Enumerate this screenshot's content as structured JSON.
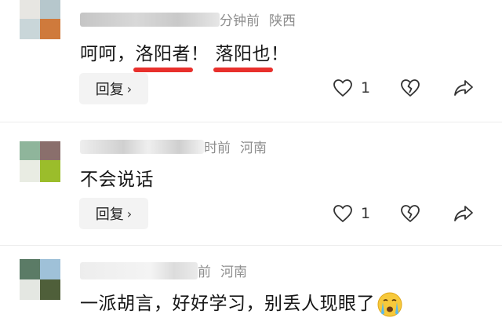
{
  "comments": [
    {
      "time_suffix": "分钟前",
      "location": "陕西",
      "text_plain": "呵呵，",
      "text_hl1": "洛阳者",
      "text_mid": "！",
      "text_hl2": "落阳也",
      "text_end": "！",
      "reply_label": "回复",
      "like_count": "1"
    },
    {
      "time_suffix": "时前",
      "location": "河南",
      "text": "不会说话",
      "reply_label": "回复",
      "like_count": "1"
    },
    {
      "time_suffix": "前",
      "location": "河南",
      "text": "一派胡言，好好学习，别丢人现眼了"
    }
  ],
  "icons": {
    "like": "heart-icon",
    "dislike": "broken-heart-icon",
    "share": "share-arrow-icon",
    "reply_chevron": "chevron-right-icon",
    "emoji": "crying-face-emoji"
  },
  "colors": {
    "highlight_underline": "#e8302c",
    "meta_text": "#8e8e8e",
    "reply_bg": "#f3f3f3"
  }
}
